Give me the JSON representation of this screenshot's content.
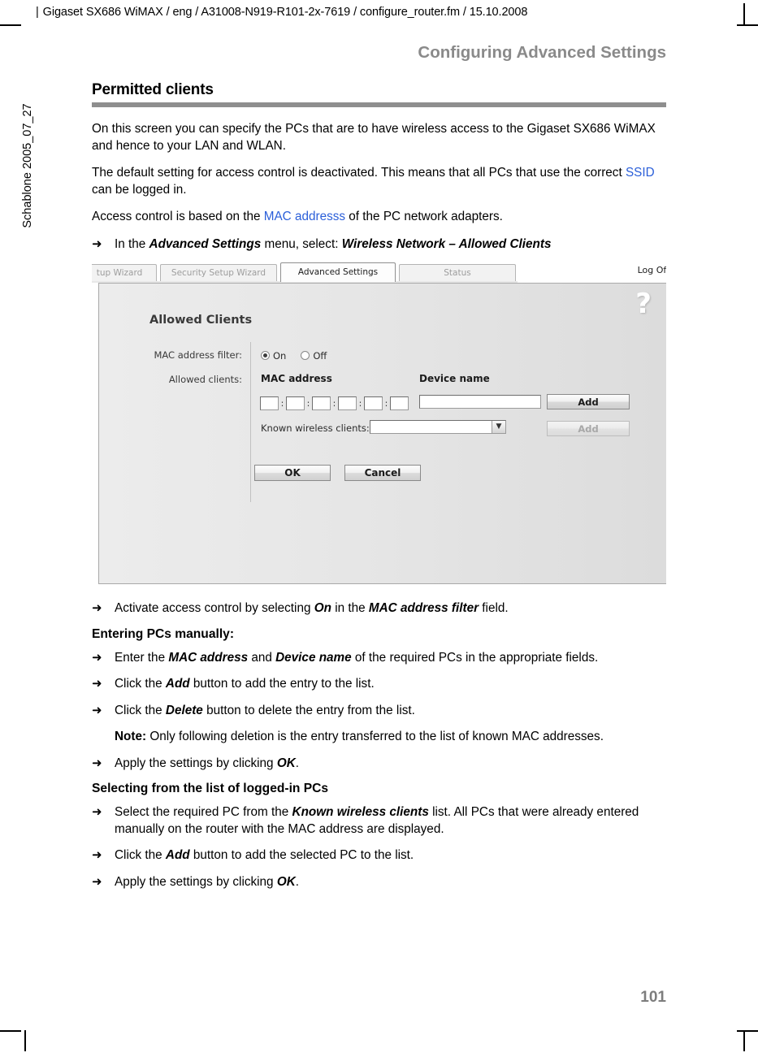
{
  "document": {
    "running_header": "Gigaset SX686 WiMAX / eng / A31008-N919-R101-2x-7619 / configure_router.fm / 15.10.2008",
    "side_text": "Schablone 2005_07_27",
    "chapter_title": "Configuring Advanced Settings",
    "page_number": "101"
  },
  "section": {
    "heading": "Permitted clients",
    "paragraph_1": "On this screen you can specify the PCs that are to have wireless access to the Gigaset SX686 WiMAX and hence to your LAN and WLAN.",
    "paragraph_2_a": "The default setting for access control is deactivated. This means that all PCs that use the correct ",
    "paragraph_2_link": "SSID",
    "paragraph_2_b": " can be logged in.",
    "paragraph_3_a": "Access control is based on the ",
    "paragraph_3_link": "MAC addresss",
    "paragraph_3_b": " of the PC network adapters.",
    "step_menu_a": "In the ",
    "step_menu_bold1": "Advanced Settings",
    "step_menu_b": " menu, select: ",
    "step_menu_bold2": "Wireless Network",
    "step_menu_dash": " – ",
    "step_menu_bold3": "Allowed Clients"
  },
  "screenshot": {
    "tabs": [
      {
        "label": "tup Wizard",
        "active": false
      },
      {
        "label": "Security Setup Wizard",
        "active": false
      },
      {
        "label": "Advanced Settings",
        "active": true
      },
      {
        "label": "Status",
        "active": false
      }
    ],
    "log_off": "Log Off",
    "help_icon": "?",
    "panel_title": "Allowed Clients",
    "label_mac_filter": "MAC address filter:",
    "label_allowed_clients": "Allowed clients:",
    "radio_on": "On",
    "radio_off": "Off",
    "radio_selected": "On",
    "col_mac_address": "MAC address",
    "col_device_name": "Device name",
    "mac_octets": [
      "",
      "",
      "",
      "",
      "",
      ""
    ],
    "mac_separator": ":",
    "device_name_value": "",
    "add_button_1": "Add",
    "add_button_2": "Add",
    "add_button_2_disabled": true,
    "label_known_clients": "Known wireless clients:",
    "known_clients_selected": "",
    "dropdown_arrow": "▼",
    "ok_button": "OK",
    "cancel_button": "Cancel"
  },
  "instructions": {
    "step_activate_a": "Activate access control by selecting ",
    "step_activate_bold1": "On",
    "step_activate_b": " in the ",
    "step_activate_bold2": "MAC address filter",
    "step_activate_c": " field.",
    "sub_manual": "Entering PCs manually:",
    "step_enter_a": "Enter the ",
    "step_enter_bold1": "MAC address",
    "step_enter_b": " and ",
    "step_enter_bold2": "Device name",
    "step_enter_c": " of the required PCs in the appropriate fields.",
    "step_add_a": "Click the ",
    "step_add_bold": "Add",
    "step_add_b": " button to add the entry to the list.",
    "step_delete_a": "Click the ",
    "step_delete_bold": "Delete",
    "step_delete_b": " button to delete the entry from the list.",
    "note_label": "Note:",
    "note_text": " Only following deletion is the entry transferred to the list of known MAC addresses.",
    "step_apply_a": "Apply the settings by clicking ",
    "step_apply_bold": "OK",
    "step_apply_b": ".",
    "sub_logged_in": "Selecting from the list of logged-in PCs",
    "step_select_a": "Select the required PC from the ",
    "step_select_bold": "Known wireless clients",
    "step_select_b": " list. All PCs that were already entered manually on the router with the MAC address are displayed.",
    "step_add2_a": "Click the ",
    "step_add2_bold": "Add",
    "step_add2_b": " button to add the selected PC to the list.",
    "step_apply2_a": "Apply the settings by clicking ",
    "step_apply2_bold": "OK",
    "step_apply2_b": ".",
    "arrow_glyph": "➜"
  }
}
